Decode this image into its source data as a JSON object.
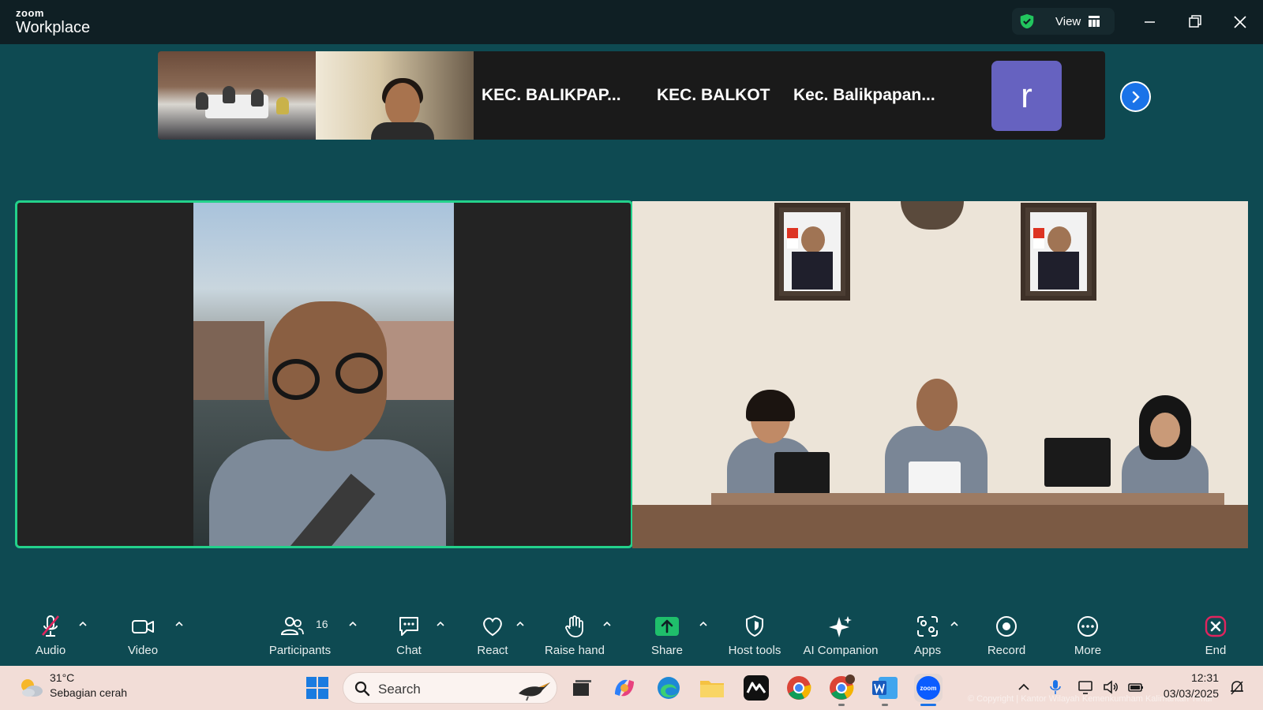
{
  "app": {
    "brand_top": "zoom",
    "brand_bottom": "Workplace",
    "view_label": "View"
  },
  "filmstrip": {
    "names": [
      "KEC.  BALIKPAP...",
      "KEC. BALKOT",
      "Kec.  Balikpapan..."
    ],
    "avatar_letter": "r"
  },
  "toolbar": {
    "audio": "Audio",
    "video": "Video",
    "participants": "Participants",
    "participants_count": "16",
    "chat": "Chat",
    "react": "React",
    "raise_hand": "Raise hand",
    "share": "Share",
    "host_tools": "Host tools",
    "ai_companion": "AI Companion",
    "apps": "Apps",
    "record": "Record",
    "more": "More",
    "end": "End"
  },
  "taskbar": {
    "weather_temp": "31°C",
    "weather_desc": "Sebagian cerah",
    "search_placeholder": "Search",
    "time": "12:31",
    "date": "03/03/2025",
    "copyright": "© Copyright | Kantor Wilayah Kemenkumham Kalimantan Timur"
  },
  "colors": {
    "accent": "#23d18b",
    "background": "#0e4a52",
    "end": "#e0245e",
    "share": "#1fbf6b"
  }
}
